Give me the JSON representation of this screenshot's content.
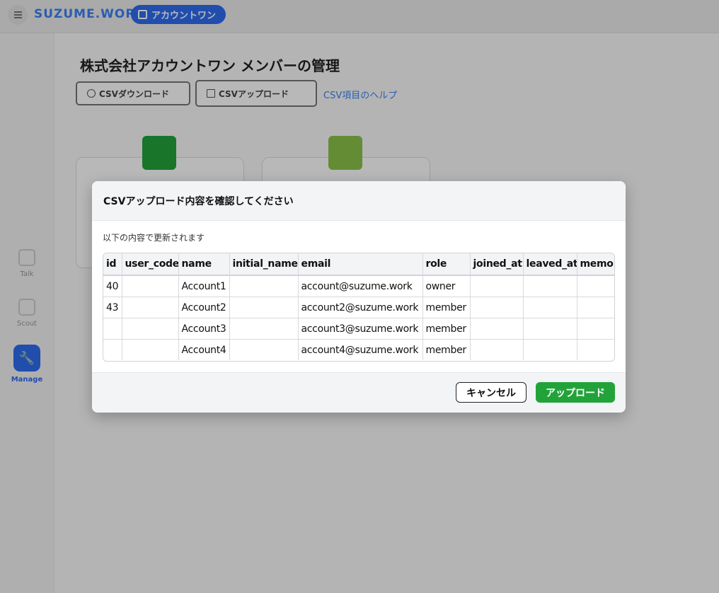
{
  "topbar": {
    "brand": "SUZUME.WORK",
    "account_pill": "アカウントワン"
  },
  "sidebar": {
    "items": [
      {
        "label": "Talk"
      },
      {
        "label": "Scout"
      },
      {
        "label": "Manage"
      }
    ]
  },
  "main": {
    "title": "株式会社アカウントワン メンバーの管理",
    "csv_download_label": "CSVダウンロード",
    "csv_upload_label": "CSVアップロード",
    "csv_help_link": "CSV項目のヘルプ"
  },
  "modal": {
    "title": "CSVアップロード内容を確認してください",
    "subtitle": "以下の内容で更新されます",
    "columns": [
      "id",
      "user_code",
      "name",
      "initial_name",
      "email",
      "role",
      "joined_at",
      "leaved_at",
      "memo"
    ],
    "rows": [
      [
        "40",
        "",
        "Account1",
        "",
        "account@suzume.work",
        "owner",
        "",
        "",
        ""
      ],
      [
        "43",
        "",
        "Account2",
        "",
        "account2@suzume.work",
        "member",
        "",
        "",
        ""
      ],
      [
        "",
        "",
        "Account3",
        "",
        "account3@suzume.work",
        "member",
        "",
        "",
        ""
      ],
      [
        "",
        "",
        "Account4",
        "",
        "account4@suzume.work",
        "member",
        "",
        "",
        ""
      ]
    ],
    "cancel_label": "キャンセル",
    "upload_label": "アップロード"
  },
  "colors": {
    "accent": "#2f6bf0",
    "upload_button": "#22a33a",
    "card_icon_1": "#22a33a",
    "card_icon_2": "#8bc34a"
  }
}
